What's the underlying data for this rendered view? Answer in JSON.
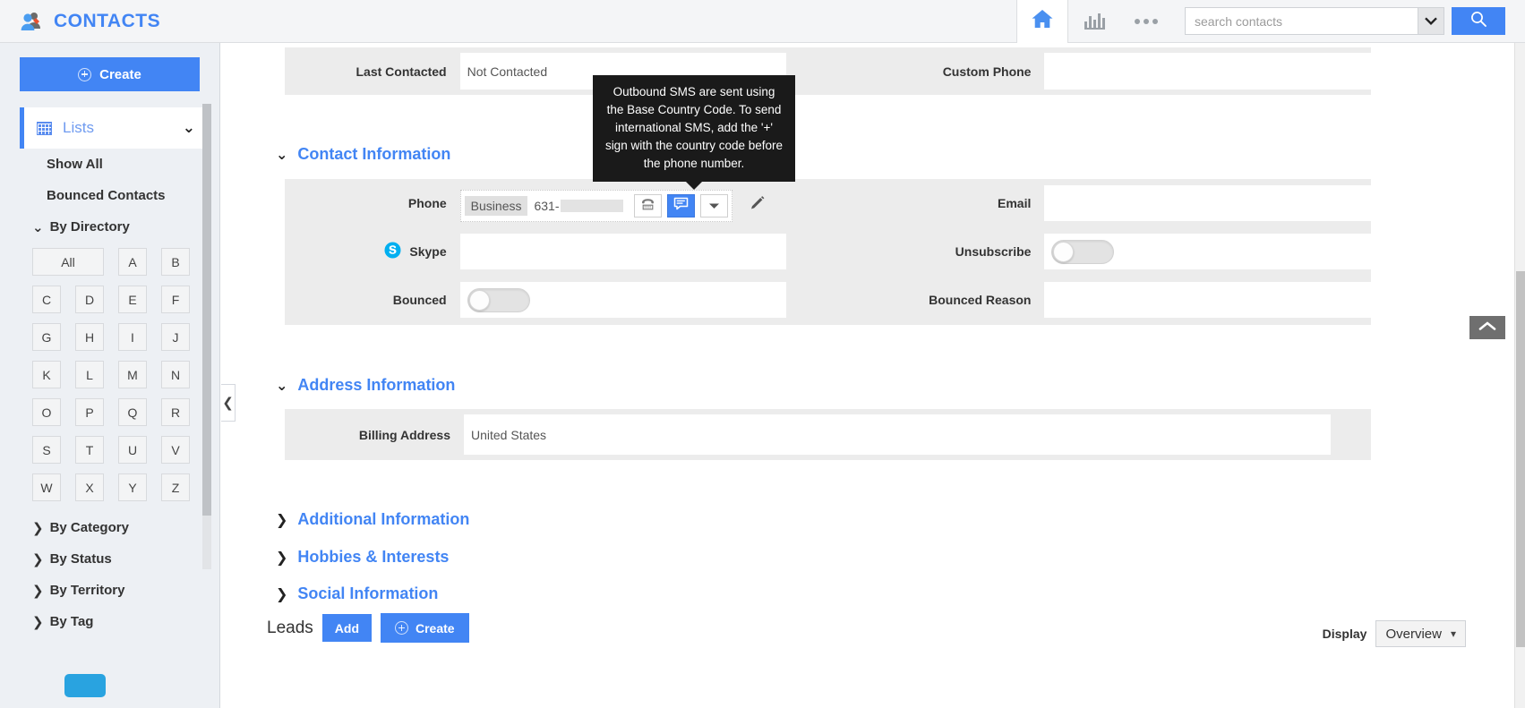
{
  "header": {
    "brand_title": "CONTACTS",
    "brand_icon": "contacts-people-icon",
    "home_icon": "home-icon",
    "chart_icon": "bar-chart-icon",
    "more_icon": "more-dots-icon",
    "search_placeholder": "search contacts",
    "search_value": "",
    "search_caret_icon": "chevron-down-icon",
    "search_button_icon": "search-icon",
    "accent_color": "#4285f4"
  },
  "sidebar": {
    "create_label": "Create",
    "lists_label": "Lists",
    "lists_icon": "grid-icon",
    "lists_chevron": "⌄",
    "items": [
      {
        "label": "Show All"
      },
      {
        "label": "Bounced Contacts"
      }
    ],
    "groups": [
      {
        "label": "By Directory",
        "expanded": true,
        "chevron": "⌄"
      },
      {
        "label": "By Category",
        "expanded": false,
        "chevron": "❯"
      },
      {
        "label": "By Status",
        "expanded": false,
        "chevron": "❯"
      },
      {
        "label": "By Territory",
        "expanded": false,
        "chevron": "❯"
      },
      {
        "label": "By Tag",
        "expanded": false,
        "chevron": "❯"
      }
    ],
    "directory_letters": [
      "All",
      "A",
      "B",
      "C",
      "D",
      "E",
      "F",
      "G",
      "H",
      "I",
      "J",
      "K",
      "L",
      "M",
      "N",
      "O",
      "P",
      "Q",
      "R",
      "S",
      "T",
      "U",
      "V",
      "W",
      "X",
      "Y",
      "Z"
    ],
    "collapse_icon": "chevron-left-icon"
  },
  "tooltip": {
    "text": "Outbound SMS are sent using the Base Country Code. To send international SMS, add the '+' sign with the country code before the phone number."
  },
  "form": {
    "top_row": {
      "left_label": "Last Contacted",
      "left_value": "Not Contacted",
      "right_label": "Custom Phone",
      "right_value": ""
    },
    "sections": [
      {
        "title": "Contact Information",
        "expanded": true,
        "chevron": "⌄",
        "fields": [
          {
            "label": "Phone",
            "value": "",
            "type": "phone"
          },
          {
            "label": "Email",
            "value": "",
            "type": "text"
          },
          {
            "label": "Skype",
            "value": "",
            "type": "text",
            "icon": "skype-icon"
          },
          {
            "label": "Unsubscribe",
            "value": "off",
            "type": "toggle"
          },
          {
            "label": "Bounced",
            "value": "off",
            "type": "toggle"
          },
          {
            "label": "Bounced Reason",
            "value": "",
            "type": "text"
          }
        ]
      },
      {
        "title": "Address Information",
        "expanded": true,
        "chevron": "⌄",
        "fields": [
          {
            "label": "Billing Address",
            "value": "United States",
            "type": "text"
          }
        ]
      },
      {
        "title": "Additional Information",
        "expanded": false,
        "chevron": "❯",
        "fields": []
      },
      {
        "title": "Hobbies & Interests",
        "expanded": false,
        "chevron": "❯",
        "fields": []
      },
      {
        "title": "Social Information",
        "expanded": false,
        "chevron": "❯",
        "fields": []
      }
    ],
    "phone": {
      "type_label": "Business",
      "number_prefix": "631-",
      "call_icon": "telephone-icon",
      "sms_icon": "sms-message-icon",
      "dropdown_icon": "caret-down-icon",
      "edit_icon": "pencil-edit-icon",
      "active_color": "#4285f4"
    }
  },
  "related": {
    "leads_label": "Leads",
    "add_label": "Add",
    "create_label": "Create",
    "display_label": "Display",
    "display_value": "Overview",
    "display_caret": "▾"
  },
  "misc": {
    "scroll_top_icon": "chevron-up-icon"
  }
}
